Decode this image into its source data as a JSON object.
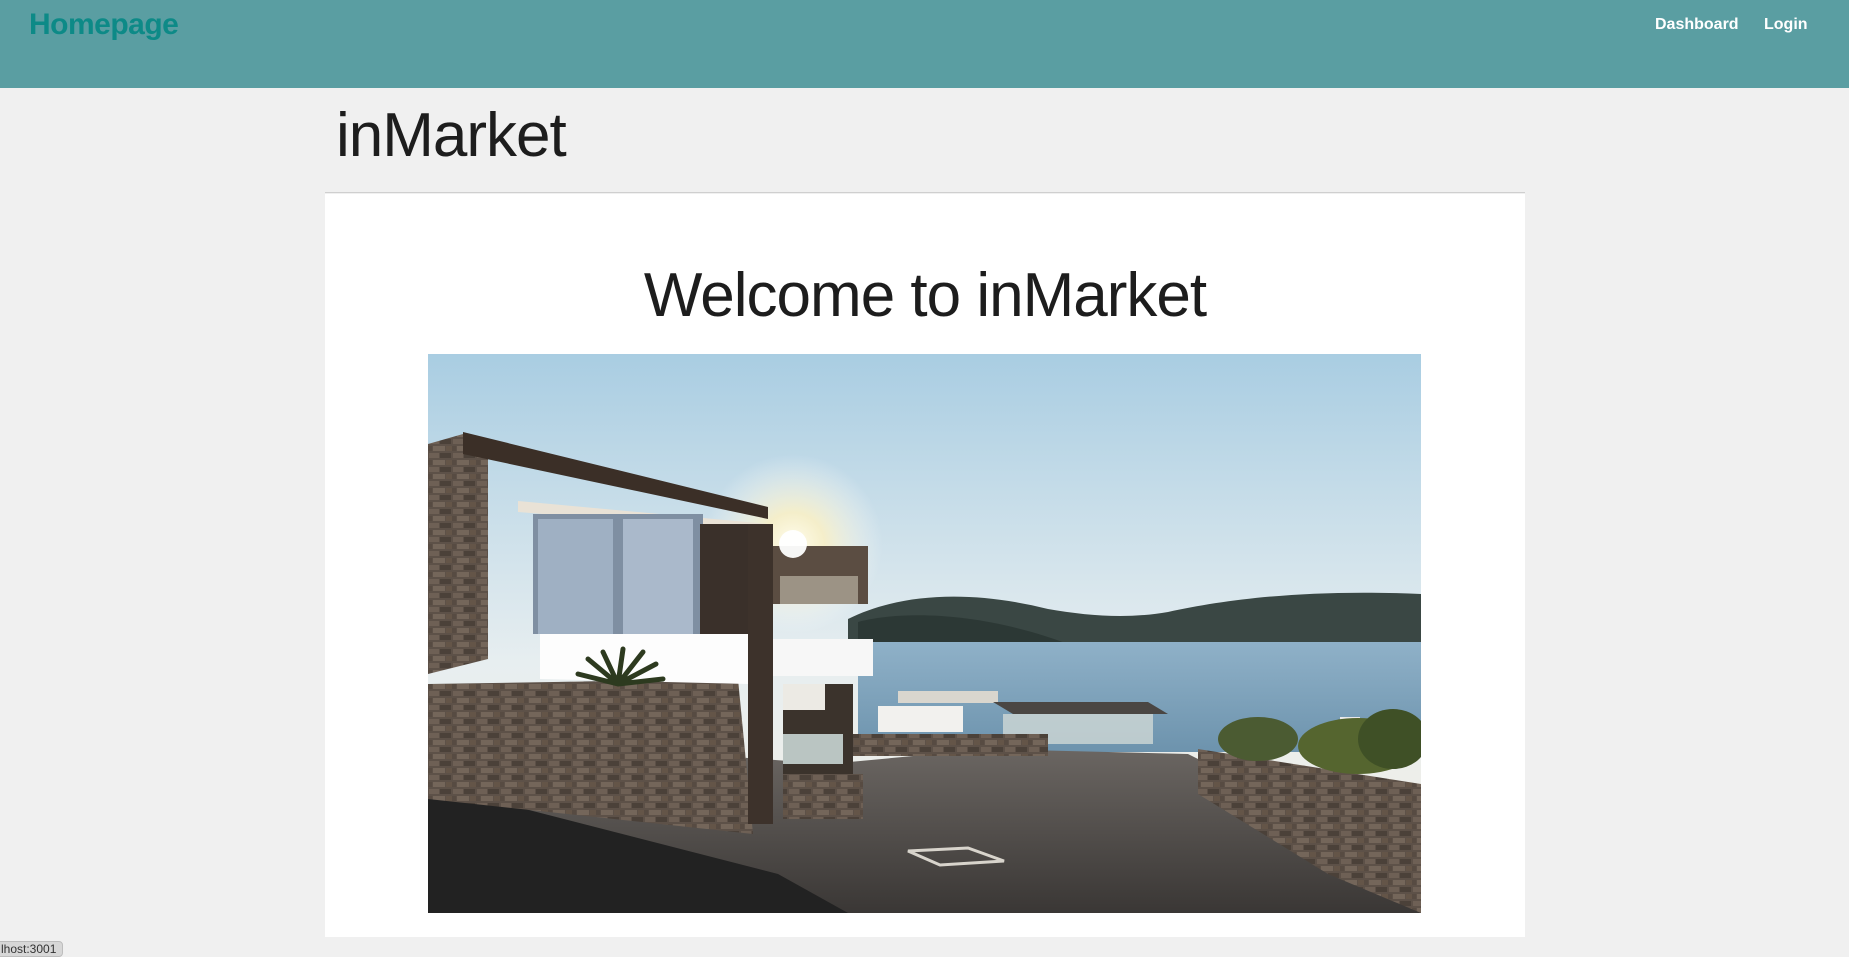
{
  "navbar": {
    "brand": "Homepage",
    "links": [
      "Dashboard",
      "Login"
    ]
  },
  "page": {
    "title": "inMarket"
  },
  "main": {
    "heading": "Welcome to inMarket",
    "hero_image_description": "seaside-villa-photo"
  },
  "status_bar": {
    "url_text": "lhost:3001"
  },
  "colors": {
    "navbar_bg": "#5a9ea2",
    "brand_text": "#0d8a87",
    "page_bg": "#f0f0f0",
    "card_bg": "#ffffff"
  }
}
